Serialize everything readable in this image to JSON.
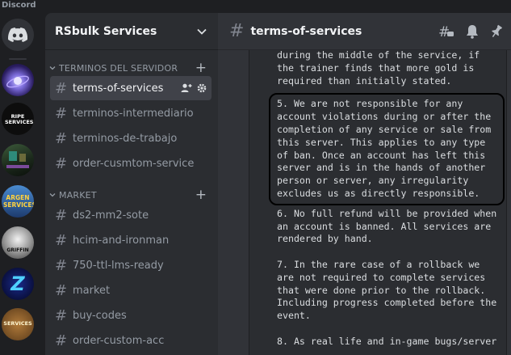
{
  "app": {
    "title": "Discord"
  },
  "servers": [
    {
      "name": "home",
      "icon": "discord-logo-icon"
    },
    {
      "name": "galaxy",
      "icon": "galaxy-server-icon"
    },
    {
      "name": "ripe-services",
      "label": "RIPE SERVICES"
    },
    {
      "name": "game-server",
      "icon": "game-server-icon"
    },
    {
      "name": "argen-services",
      "label": "ARGEN SERVICES"
    },
    {
      "name": "griffin",
      "label": "GRIFFIN"
    },
    {
      "name": "z-server",
      "label": "Z"
    },
    {
      "name": "services-gold",
      "label": "SERVICES"
    }
  ],
  "sidebar": {
    "server_name": "RSbulk Services",
    "categories": [
      {
        "label": "TERMINOS DEL SERVIDOR",
        "channels": [
          {
            "name": "terms-of-services",
            "selected": true
          },
          {
            "name": "terminos-intermediario"
          },
          {
            "name": "terminos-de-trabajo"
          },
          {
            "name": "order-cusmtom-service"
          }
        ]
      },
      {
        "label": "MARKET",
        "channels": [
          {
            "name": "ds2-mm2-sote"
          },
          {
            "name": "hcim-and-ironman"
          },
          {
            "name": "750-ttl-lms-ready"
          },
          {
            "name": "market"
          },
          {
            "name": "buy-codes"
          },
          {
            "name": "order-custom-acc"
          }
        ]
      }
    ]
  },
  "channel_header": {
    "hash": "#",
    "title": "terms-of-services"
  },
  "message": {
    "p0": "during the middle of the service, if\nthe trainer finds that more gold is\nrequired than initially stated.",
    "p5": "5. We are not responsible for any\naccount violations during or after the\ncompletion of any service or sale from\nthis server. This applies to any type\nof ban. Once an account has left this\nserver and is in the hands of another\nperson or server, any irregularity\nexcludes us as directly responsible.",
    "p6": "6. No full refund will be provided when\nan account is banned. All services are\nrendered by hand.",
    "p7": "7. In the rare case of a rollback we\nare not required to complete services\nthat were done prior to the rollback.\nIncluding progress completed before the\nevent.",
    "p8": "8. As real life and in-game bugs/server"
  },
  "colors": {
    "accent_selected": "#404249",
    "highlight_border": "#000000"
  }
}
